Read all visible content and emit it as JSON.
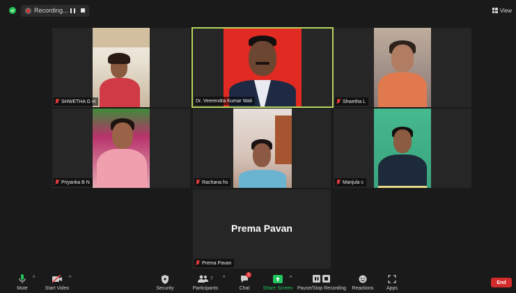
{
  "top_bar": {
    "recording_label": "Recording...",
    "view_label": "View"
  },
  "participants": [
    {
      "name": "SHWETHA G H",
      "muted": true
    },
    {
      "name": "Dr. Veerendra Kumar Wali",
      "muted": false,
      "active_speaker": true
    },
    {
      "name": "Shwetha L",
      "muted": true
    },
    {
      "name": "Priyanka B N",
      "muted": true
    },
    {
      "name": "Rachana hs",
      "muted": true
    },
    {
      "name": "Manjula c",
      "muted": true
    },
    {
      "name": "Prema Pavan",
      "muted": true,
      "video_off": true,
      "display_name": "Prema Pavan"
    }
  ],
  "toolbar": {
    "mute": "Mute",
    "start_video": "Start Video",
    "security": "Security",
    "participants": "Participants",
    "participants_count": "7",
    "chat": "Chat",
    "chat_badge": "1",
    "share_screen": "Share Screen",
    "pause_stop_recording": "Pause/Stop Recording",
    "reactions": "Reactions",
    "apps": "Apps",
    "end": "End"
  },
  "colors": {
    "active_speaker_border": "#b7d65c",
    "end_button": "#d42b2b",
    "share_screen": "#22c55e",
    "recording": "#e02828"
  }
}
